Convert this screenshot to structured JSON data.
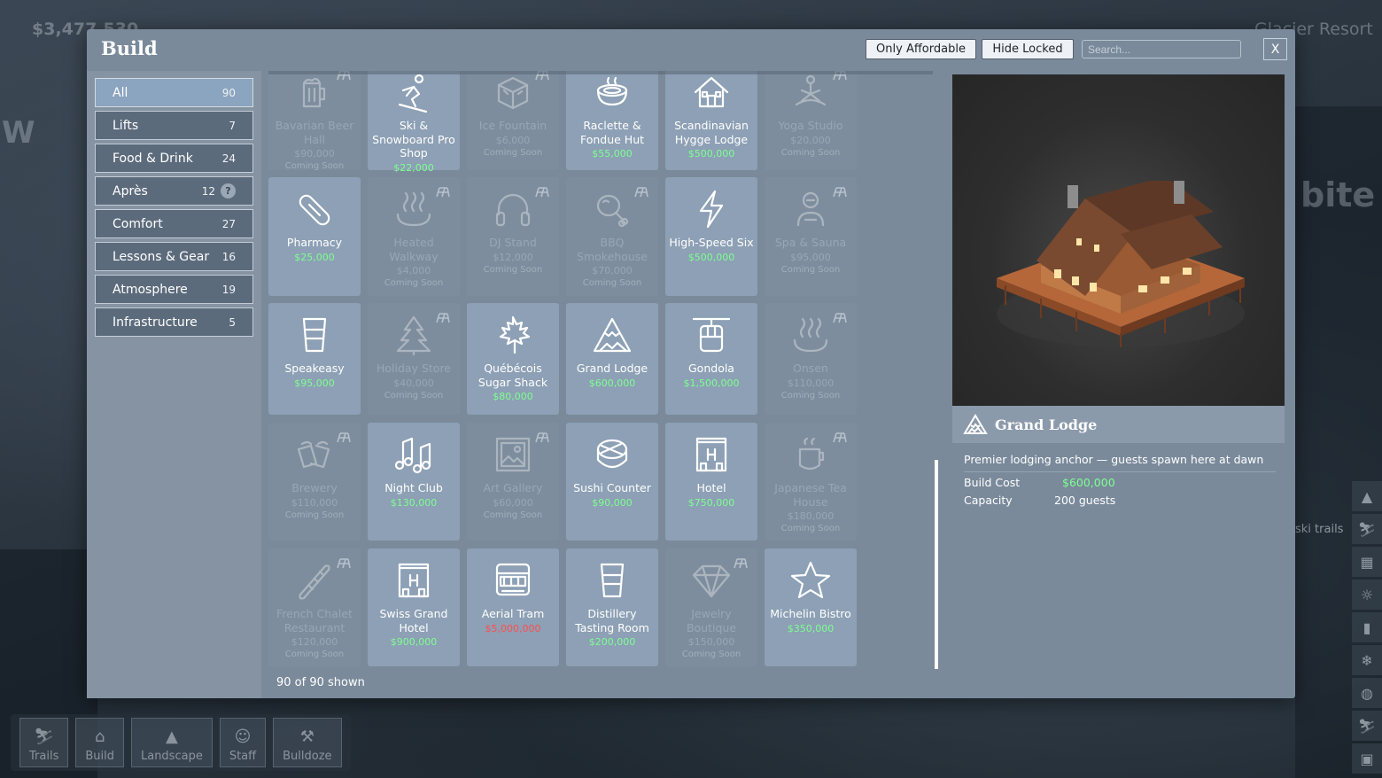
{
  "hud": {
    "money": "$3,477,530",
    "resort": "Glacier Resort"
  },
  "background": {
    "word_left": "W",
    "word_right": "bite",
    "ski_trails": "ski trails"
  },
  "toolbar": [
    {
      "label": "Trails",
      "icon": "skier-icon"
    },
    {
      "label": "Build",
      "icon": "build-icon"
    },
    {
      "label": "Landscape",
      "icon": "mountain-icon"
    },
    {
      "label": "Staff",
      "icon": "person-icon"
    },
    {
      "label": "Bulldoze",
      "icon": "bulldoze-icon"
    }
  ],
  "modal": {
    "title": "Build",
    "only_affordable": "Only Affordable",
    "hide_locked": "Hide Locked",
    "search_placeholder": "Search...",
    "close": "X",
    "footer": "90 of 90 shown"
  },
  "categories": [
    {
      "label": "All",
      "count": "90",
      "active": true
    },
    {
      "label": "Lifts",
      "count": "7"
    },
    {
      "label": "Food & Drink",
      "count": "24"
    },
    {
      "label": "Après",
      "count": "12",
      "help": "?"
    },
    {
      "label": "Comfort",
      "count": "27"
    },
    {
      "label": "Lessons & Gear",
      "count": "16"
    },
    {
      "label": "Atmosphere",
      "count": "19"
    },
    {
      "label": "Infrastructure",
      "count": "5"
    }
  ],
  "items": [
    {
      "name": "Bavarian Beer Hall",
      "price": "$90,000",
      "status": "Coming Soon",
      "locked": true,
      "icon": "beer-icon"
    },
    {
      "name": "Ski & Snowboard Pro Shop",
      "price": "$22,000",
      "locked": false,
      "icon": "skier-icon"
    },
    {
      "name": "Ice Fountain",
      "price": "$6,000",
      "status": "Coming Soon",
      "locked": true,
      "icon": "ice-cube-icon"
    },
    {
      "name": "Raclette & Fondue Hut",
      "price": "$55,000",
      "locked": false,
      "icon": "pot-icon"
    },
    {
      "name": "Scandinavian Hygge Lodge",
      "price": "$500,000",
      "locked": false,
      "icon": "cabin-icon"
    },
    {
      "name": "Yoga Studio",
      "price": "$20,000",
      "status": "Coming Soon",
      "locked": true,
      "icon": "yoga-icon"
    },
    {
      "name": "Pharmacy",
      "price": "$25,000",
      "locked": false,
      "icon": "pill-icon"
    },
    {
      "name": "Heated Walkway",
      "price": "$4,000",
      "status": "Coming Soon",
      "locked": true,
      "icon": "steam-icon"
    },
    {
      "name": "DJ Stand",
      "price": "$12,000",
      "status": "Coming Soon",
      "locked": true,
      "icon": "headphones-icon"
    },
    {
      "name": "BBQ Smokehouse",
      "price": "$70,000",
      "status": "Coming Soon",
      "locked": true,
      "icon": "drumstick-icon"
    },
    {
      "name": "High-Speed Six",
      "price": "$500,000",
      "locked": false,
      "icon": "lightning-icon"
    },
    {
      "name": "Spa & Sauna",
      "price": "$95,000",
      "status": "Coming Soon",
      "locked": true,
      "icon": "spa-icon"
    },
    {
      "name": "Speakeasy",
      "price": "$95,000",
      "locked": false,
      "icon": "glass-icon"
    },
    {
      "name": "Holiday Store",
      "price": "$40,000",
      "status": "Coming Soon",
      "locked": true,
      "icon": "tree-icon"
    },
    {
      "name": "Québécois Sugar Shack",
      "price": "$80,000",
      "locked": false,
      "icon": "maple-leaf-icon"
    },
    {
      "name": "Grand Lodge",
      "price": "$600,000",
      "locked": false,
      "icon": "mountain-icon"
    },
    {
      "name": "Gondola",
      "price": "$1,500,000",
      "locked": false,
      "icon": "gondola-icon"
    },
    {
      "name": "Onsen",
      "price": "$110,000",
      "status": "Coming Soon",
      "locked": true,
      "icon": "steam-icon"
    },
    {
      "name": "Brewery",
      "price": "$110,000",
      "status": "Coming Soon",
      "locked": true,
      "icon": "beer-cheers-icon"
    },
    {
      "name": "Night Club",
      "price": "$130,000",
      "locked": false,
      "icon": "music-notes-icon"
    },
    {
      "name": "Art Gallery",
      "price": "$60,000",
      "status": "Coming Soon",
      "locked": true,
      "icon": "picture-icon"
    },
    {
      "name": "Sushi Counter",
      "price": "$90,000",
      "locked": false,
      "icon": "sushi-icon"
    },
    {
      "name": "Hotel",
      "price": "$750,000",
      "locked": false,
      "icon": "hotel-icon"
    },
    {
      "name": "Japanese Tea House",
      "price": "$180,000",
      "status": "Coming Soon",
      "locked": true,
      "icon": "tea-cup-icon"
    },
    {
      "name": "French Chalet Restaurant",
      "price": "$120,000",
      "status": "Coming Soon",
      "locked": true,
      "icon": "baguette-icon"
    },
    {
      "name": "Swiss Grand Hotel",
      "price": "$900,000",
      "locked": false,
      "icon": "hotel-icon"
    },
    {
      "name": "Aerial Tram",
      "price": "$5,000,000",
      "locked": false,
      "unaffordable": true,
      "icon": "tram-icon"
    },
    {
      "name": "Distillery Tasting Room",
      "price": "$200,000",
      "locked": false,
      "icon": "glass-icon"
    },
    {
      "name": "Jewelry Boutique",
      "price": "$150,000",
      "status": "Coming Soon",
      "locked": true,
      "icon": "diamond-icon"
    },
    {
      "name": "Michelin Bistro",
      "price": "$350,000",
      "locked": false,
      "icon": "star-icon"
    }
  ],
  "detail": {
    "title": "Grand Lodge",
    "icon": "mountain-icon",
    "description": "Premier lodging anchor — guests spawn here at dawn",
    "build_cost_label": "Build Cost",
    "build_cost": "$600,000",
    "capacity_label": "Capacity",
    "capacity": "200 guests"
  }
}
